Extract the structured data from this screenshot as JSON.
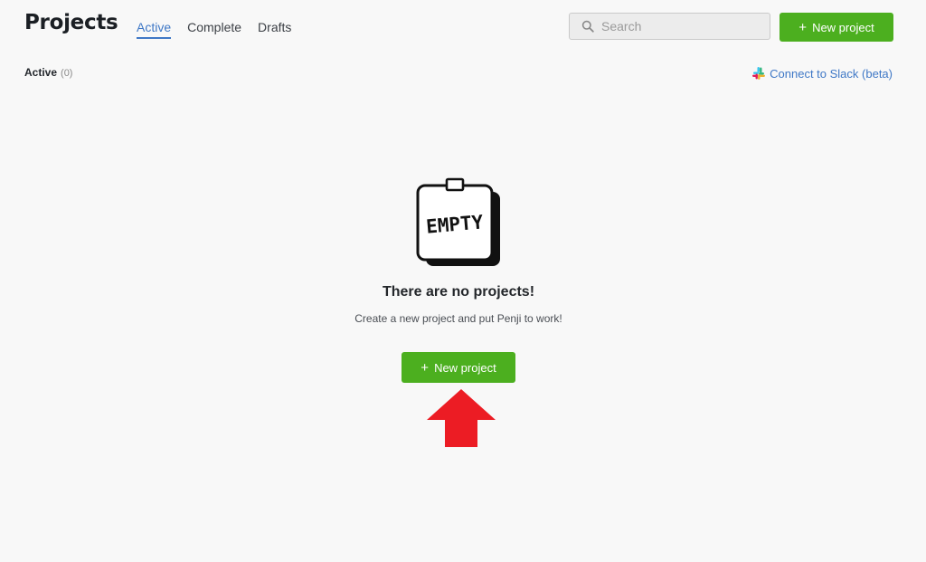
{
  "header": {
    "title": "Projects",
    "tabs": [
      {
        "label": "Active",
        "active": true
      },
      {
        "label": "Complete",
        "active": false
      },
      {
        "label": "Drafts",
        "active": false
      }
    ],
    "search": {
      "placeholder": "Search",
      "value": ""
    },
    "new_project_label": "New project"
  },
  "subheader": {
    "section_label": "Active",
    "section_count": "(0)",
    "slack_link_label": "Connect to Slack (beta)"
  },
  "empty_state": {
    "illustration_text": "EMPTY",
    "title": "There are no projects!",
    "subtitle": "Create a new project and put Penji to work!",
    "button_label": "New project"
  },
  "colors": {
    "accent_green": "#4caf1f",
    "link_blue": "#3f78c6",
    "annotation_arrow": "#ec1c24"
  },
  "icons": [
    "search-icon",
    "plus-icon",
    "slack-icon",
    "empty-notepad-illustration",
    "red-arrow-annotation"
  ]
}
